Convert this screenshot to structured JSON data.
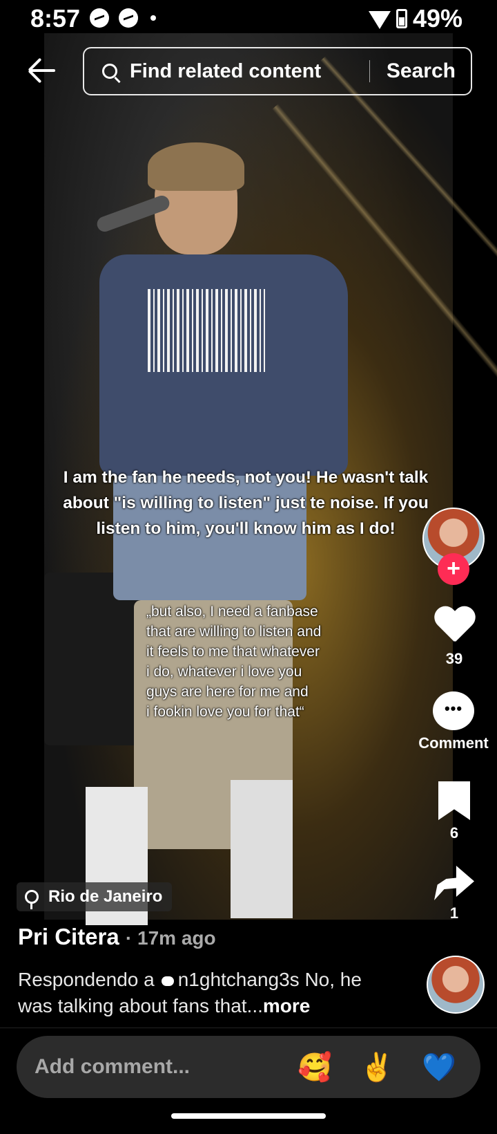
{
  "status": {
    "time": "8:57",
    "battery": "49%"
  },
  "search": {
    "placeholder": "Find related content",
    "button": "Search"
  },
  "video": {
    "caption_main": "I am the fan he needs, not you! He wasn't talk\nabout \"is willing to listen\" just te noise. If you\nlisten to him, you'll know him as I do!",
    "caption_quote": "„but also, I need a fanbase\nthat are willing to listen and\nit feels to me that whatever\ni do, whatever i love you\nguys are here for me and\ni fookin love you for that“"
  },
  "rail": {
    "likes": "39",
    "comment_label": "Comment",
    "saves": "6",
    "shares": "1"
  },
  "location": "Rio de Janeiro",
  "post": {
    "author": "Pri Citera",
    "time_ago": "· 17m ago",
    "reply_prefix": "Respondendo a",
    "reply_user": "n1ghtchang3s",
    "desc_text": " No, he was talking about fans that...",
    "more": "more"
  },
  "comment": {
    "placeholder": "Add comment...",
    "emojis": [
      "🥰",
      "✌️",
      "💙"
    ]
  }
}
